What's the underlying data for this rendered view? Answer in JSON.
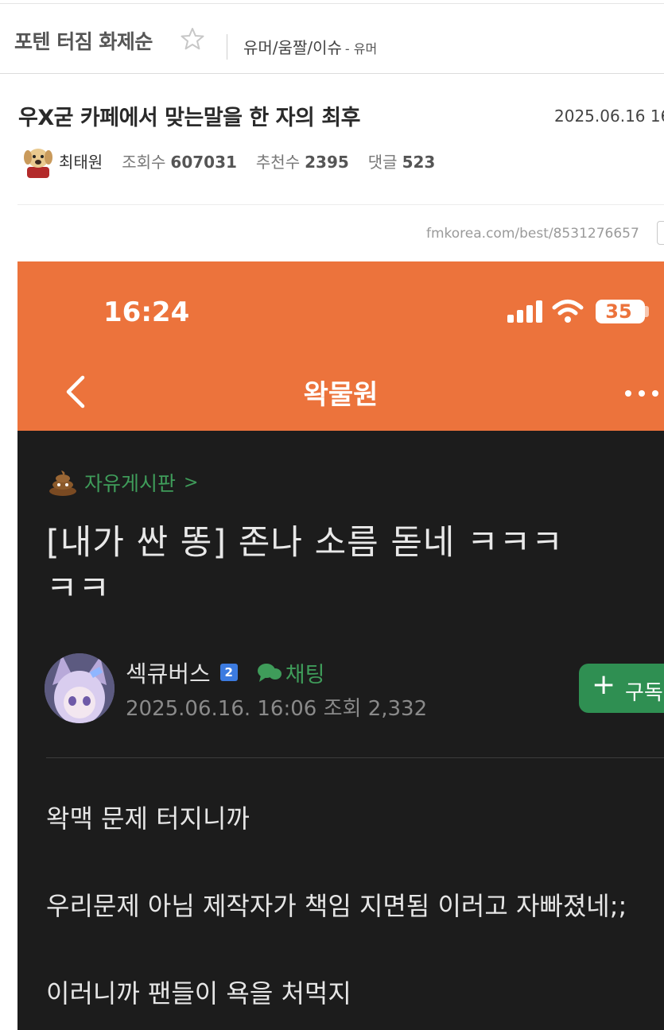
{
  "crumb": {
    "title": "포텐 터짐 화제순",
    "category": "유머/움짤/이슈",
    "sub": "- 유머"
  },
  "post": {
    "title": "우X굳 카페에서 맞는말을 한 자의 최후",
    "date": "2025.06.16 16",
    "author": "최태원",
    "views_label": "조회수",
    "views": "607031",
    "votes_label": "추천수",
    "votes": "2395",
    "comments_label": "댓글",
    "comments": "523",
    "url": "fmkorea.com/best/8531276657"
  },
  "screenshot": {
    "status_time": "16:24",
    "battery": "35",
    "header_title": "왁물원",
    "board": "자유게시판",
    "board_arrow": ">",
    "title_line1": "[내가 싼 똥] 존나 소름 돋네 ㅋㅋㅋ",
    "title_line2": "ㅋㅋ",
    "author": "섹큐버스",
    "level": "2",
    "chat": "채팅",
    "meta": "2025.06.16. 16:06 조회 2,332",
    "subscribe": "구독",
    "body": [
      "왁맥 문제 터지니까",
      "우리문제 아님 제작자가 책임 지면됨 이러고 자빠졌네;;",
      "이러니까 팬들이 욕을 처먹지"
    ],
    "colors": {
      "header": "#ec733c",
      "background": "#1c1c1c",
      "accent_green": "#3f9c5a"
    }
  }
}
